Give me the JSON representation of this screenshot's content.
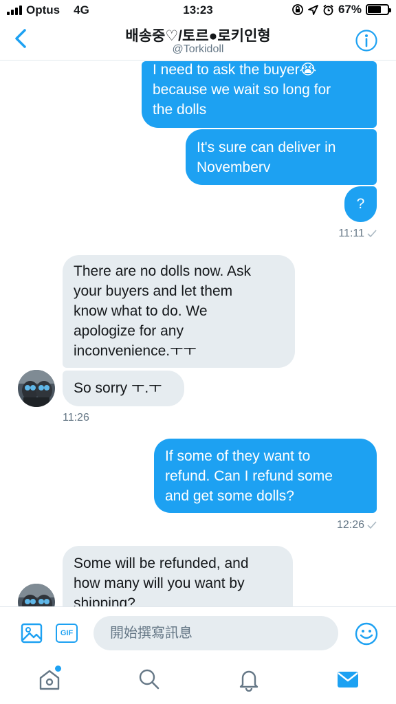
{
  "status_bar": {
    "carrier": "Optus",
    "network": "4G",
    "time": "13:23",
    "battery": "67%",
    "battery_level": 0.67
  },
  "header": {
    "title": "배송중♡/토르●로키인형",
    "handle": "@Torkidoll"
  },
  "messages": [
    {
      "direction": "out",
      "lines": [
        "I need to ask the buyer😭",
        "because we wait so long for",
        "the dolls"
      ]
    },
    {
      "direction": "out",
      "lines": [
        "It's sure can deliver in",
        "Novemberv"
      ]
    },
    {
      "direction": "out",
      "lines": [
        "?"
      ],
      "time": "11:11"
    },
    {
      "direction": "in",
      "lines": [
        "There are no dolls now. Ask",
        "your buyers and let them",
        "know what to do. We",
        "apologize for any",
        "inconvenience.ㅜㅜ"
      ]
    },
    {
      "direction": "in",
      "lines": [
        "So sorry ㅜ.ㅜ"
      ],
      "time": "11:26"
    },
    {
      "direction": "out",
      "lines": [
        "If some of they want to",
        "refund. Can I refund some",
        "and get some dolls?"
      ],
      "time": "12:26"
    },
    {
      "direction": "in",
      "lines": [
        "Some will be refunded, and",
        "how many will you want by",
        "shipping?"
      ]
    }
  ],
  "composer": {
    "placeholder": "開始撰寫訊息",
    "gif_label": "GIF"
  },
  "colors": {
    "accent": "#1da1f2",
    "incoming_bubble": "#e6ecf0",
    "muted_text": "#657786"
  },
  "icons": [
    "back-chevron-icon",
    "info-icon",
    "image-icon",
    "gif-icon",
    "emoji-icon",
    "home-icon",
    "search-icon",
    "notifications-icon",
    "messages-icon"
  ]
}
